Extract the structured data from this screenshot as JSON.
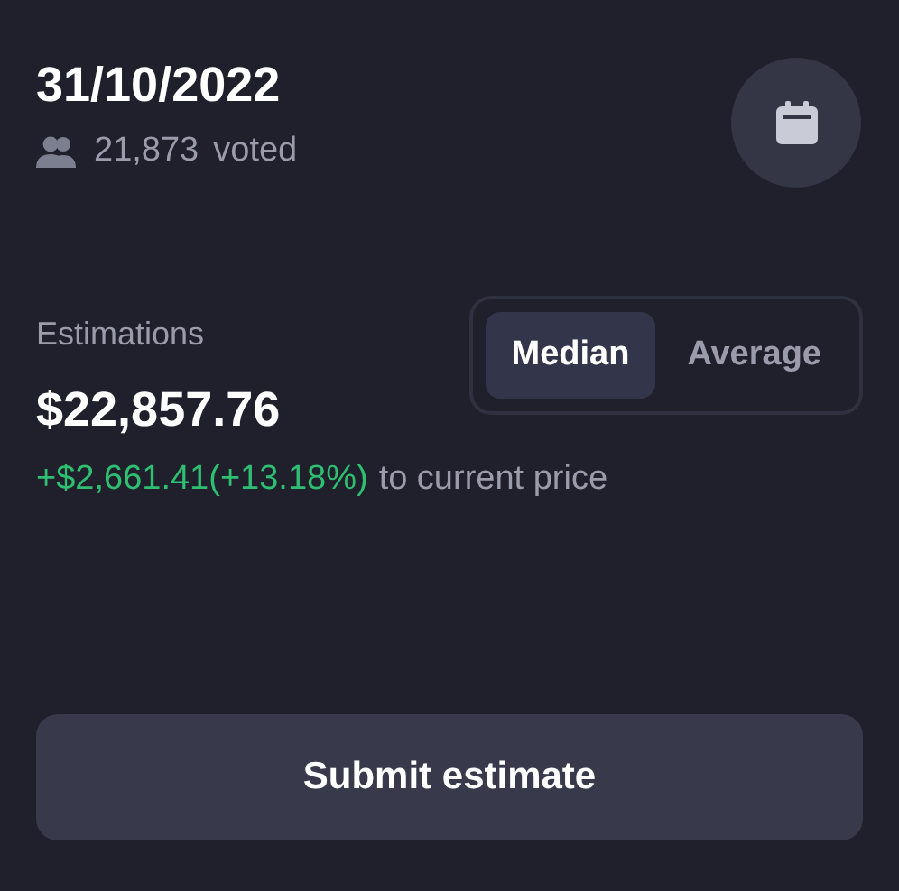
{
  "date": "31/10/2022",
  "votes": {
    "count": "21,873",
    "label": "voted"
  },
  "estimations": {
    "label": "Estimations",
    "value": "$22,857.76",
    "change": "+$2,661.41(+13.18%)",
    "change_suffix": "to current price"
  },
  "modes": [
    {
      "label": "Median",
      "selected": true
    },
    {
      "label": "Average",
      "selected": false
    }
  ],
  "submit_button": "Submit estimate"
}
